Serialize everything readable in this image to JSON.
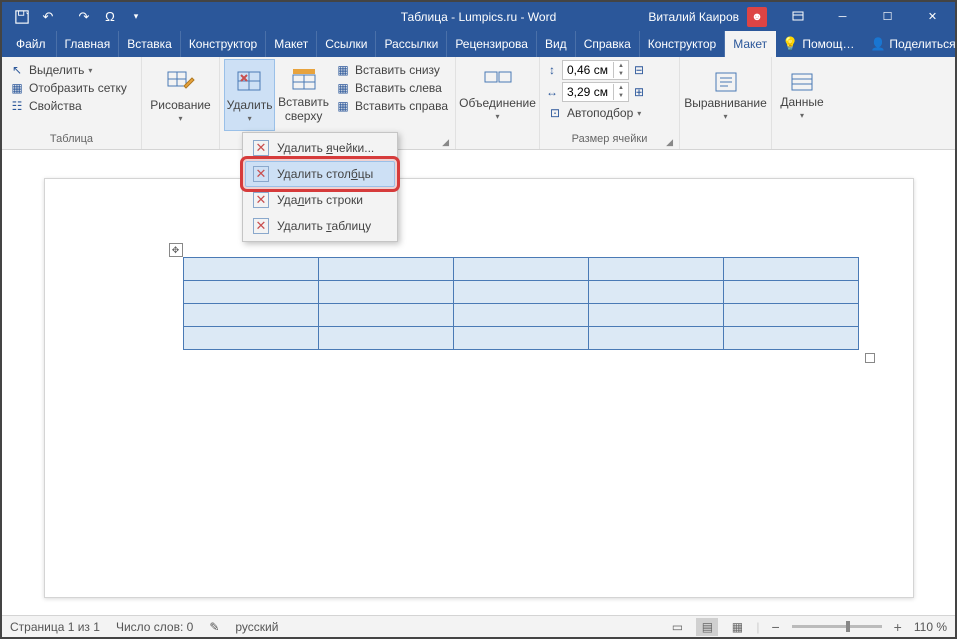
{
  "title": "Таблица - Lumpics.ru - Word",
  "user": {
    "name": "Виталий Каиров"
  },
  "tabs": {
    "file": "Файл",
    "items": [
      "Главная",
      "Вставка",
      "Конструктор",
      "Макет",
      "Ссылки",
      "Рассылки",
      "Рецензирова",
      "Вид",
      "Справка",
      "Конструктор",
      "Макет"
    ],
    "active_index": 10,
    "help_placeholder": "Помощ…",
    "share": "Поделиться"
  },
  "ribbon": {
    "table_group": {
      "label": "Таблица",
      "select": "Выделить",
      "gridlines": "Отобразить сетку",
      "properties": "Свойства"
    },
    "draw_group": {
      "label": "Рисование"
    },
    "rows_cols": {
      "delete": "Удалить",
      "insert_top": "Вставить сверху",
      "insert_bottom": "Вставить снизу",
      "insert_left": "Вставить слева",
      "insert_right": "Вставить справа"
    },
    "merge": {
      "label": "Объединение"
    },
    "cell_size": {
      "label": "Размер ячейки",
      "height": "0,46 см",
      "width": "3,29 см",
      "autofit": "Автоподбор"
    },
    "alignment": {
      "label": "Выравнивание"
    },
    "data": {
      "label": "Данные"
    }
  },
  "delete_menu": {
    "cells": "Удалить ячейки...",
    "columns": "Удалить столбцы",
    "rows": "Удалить строки",
    "table": "Удалить таблицу"
  },
  "status": {
    "page": "Страница 1 из 1",
    "words": "Число слов: 0",
    "lang": "русский",
    "zoom": "110 %"
  }
}
